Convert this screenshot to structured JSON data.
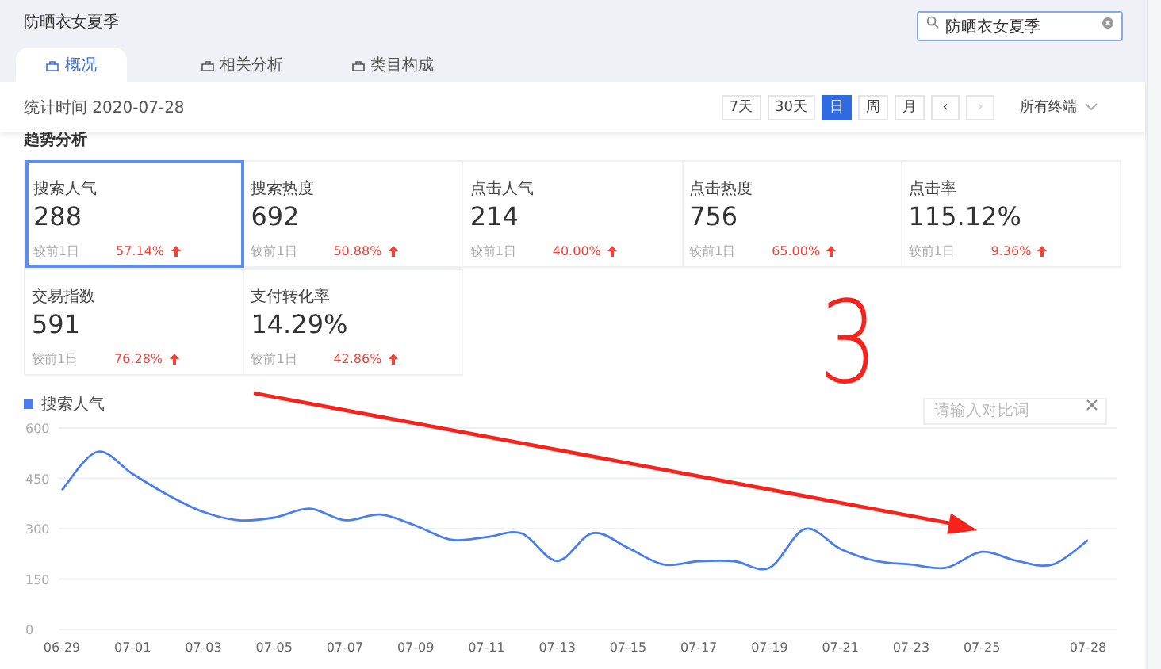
{
  "header": {
    "title": "防晒衣女夏季",
    "search": {
      "value": "防晒衣女夏季"
    }
  },
  "tabs": [
    {
      "label": "概况",
      "selected": true
    },
    {
      "label": "相关分析",
      "selected": false
    },
    {
      "label": "类目构成",
      "selected": false
    }
  ],
  "toolbar": {
    "stat_time": "统计时间 2020-07-28",
    "ranges": [
      {
        "label": "7天",
        "selected": false
      },
      {
        "label": "30天",
        "selected": false
      },
      {
        "label": "日",
        "selected": true
      },
      {
        "label": "周",
        "selected": false
      },
      {
        "label": "月",
        "selected": false
      }
    ],
    "prev": "‹",
    "next": "›",
    "terminal": "所有终端"
  },
  "section_title": "趋势分析",
  "metrics": [
    {
      "label": "搜索人气",
      "value": "288",
      "compare": "较前1日",
      "change": "57.14%",
      "selected": true
    },
    {
      "label": "搜索热度",
      "value": "692",
      "compare": "较前1日",
      "change": "50.88%",
      "selected": false
    },
    {
      "label": "点击人气",
      "value": "214",
      "compare": "较前1日",
      "change": "40.00%",
      "selected": false
    },
    {
      "label": "点击热度",
      "value": "756",
      "compare": "较前1日",
      "change": "65.00%",
      "selected": false
    },
    {
      "label": "点击率",
      "value": "115.12%",
      "compare": "较前1日",
      "change": "9.36%",
      "selected": false
    },
    {
      "label": "交易指数",
      "value": "591",
      "compare": "较前1日",
      "change": "76.28%",
      "selected": false
    },
    {
      "label": "支付转化率",
      "value": "14.29%",
      "compare": "较前1日",
      "change": "42.86%",
      "selected": false
    }
  ],
  "compare_field": {
    "placeholder": "请输入对比词"
  },
  "chart_data": {
    "type": "line",
    "x": [
      "06-29",
      null,
      "07-01",
      null,
      "07-03",
      null,
      "07-05",
      null,
      "07-07",
      null,
      "07-09",
      null,
      "07-11",
      null,
      "07-13",
      null,
      "07-15",
      null,
      "07-17",
      null,
      "07-19",
      null,
      "07-21",
      null,
      "07-23",
      null,
      "07-25",
      null,
      null,
      "07-28"
    ],
    "grid": true,
    "series": [
      {
        "name": "搜索人气",
        "color": "#4a7ef0",
        "values": [
          415,
          529,
          463,
          400,
          350,
          325,
          333,
          360,
          325,
          342,
          309,
          267,
          275,
          286,
          204,
          287,
          243,
          193,
          203,
          203,
          184,
          299,
          240,
          204,
          193,
          184,
          231,
          204,
          193,
          266
        ]
      }
    ],
    "ylim": [
      0,
      600
    ],
    "yticks": [
      0,
      150,
      300,
      450,
      600
    ]
  },
  "annotation": {
    "text": "3"
  }
}
